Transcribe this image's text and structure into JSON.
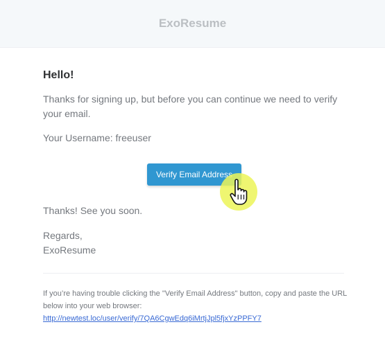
{
  "header": {
    "brand": "ExoResume"
  },
  "email": {
    "greeting": "Hello!",
    "intro": "Thanks for signing up, but before you can continue we need to verify your email.",
    "username_line": "Your Username: freeuser",
    "button_label": "Verify Email Address",
    "thanks": "Thanks! See you soon.",
    "regards": "Regards,",
    "signature": "ExoResume",
    "subcopy_text": "If you’re having trouble clicking the \"Verify Email Address\" button, copy and paste the URL below into your web browser: ",
    "subcopy_link": "http://newtest.loc/user/verify/7QA6CgwEdq6iMrtjJpl5fjxYzPPFY7"
  },
  "colors": {
    "header_bg": "#f5f8fa",
    "brand_text": "#bbbfc3",
    "heading": "#2f3133",
    "body_text": "#74787e",
    "button_bg": "#3097d1",
    "link": "#3869d4",
    "cursor_highlight": "#ecf458"
  },
  "icons": {
    "cursor": "hand-pointer-icon"
  }
}
